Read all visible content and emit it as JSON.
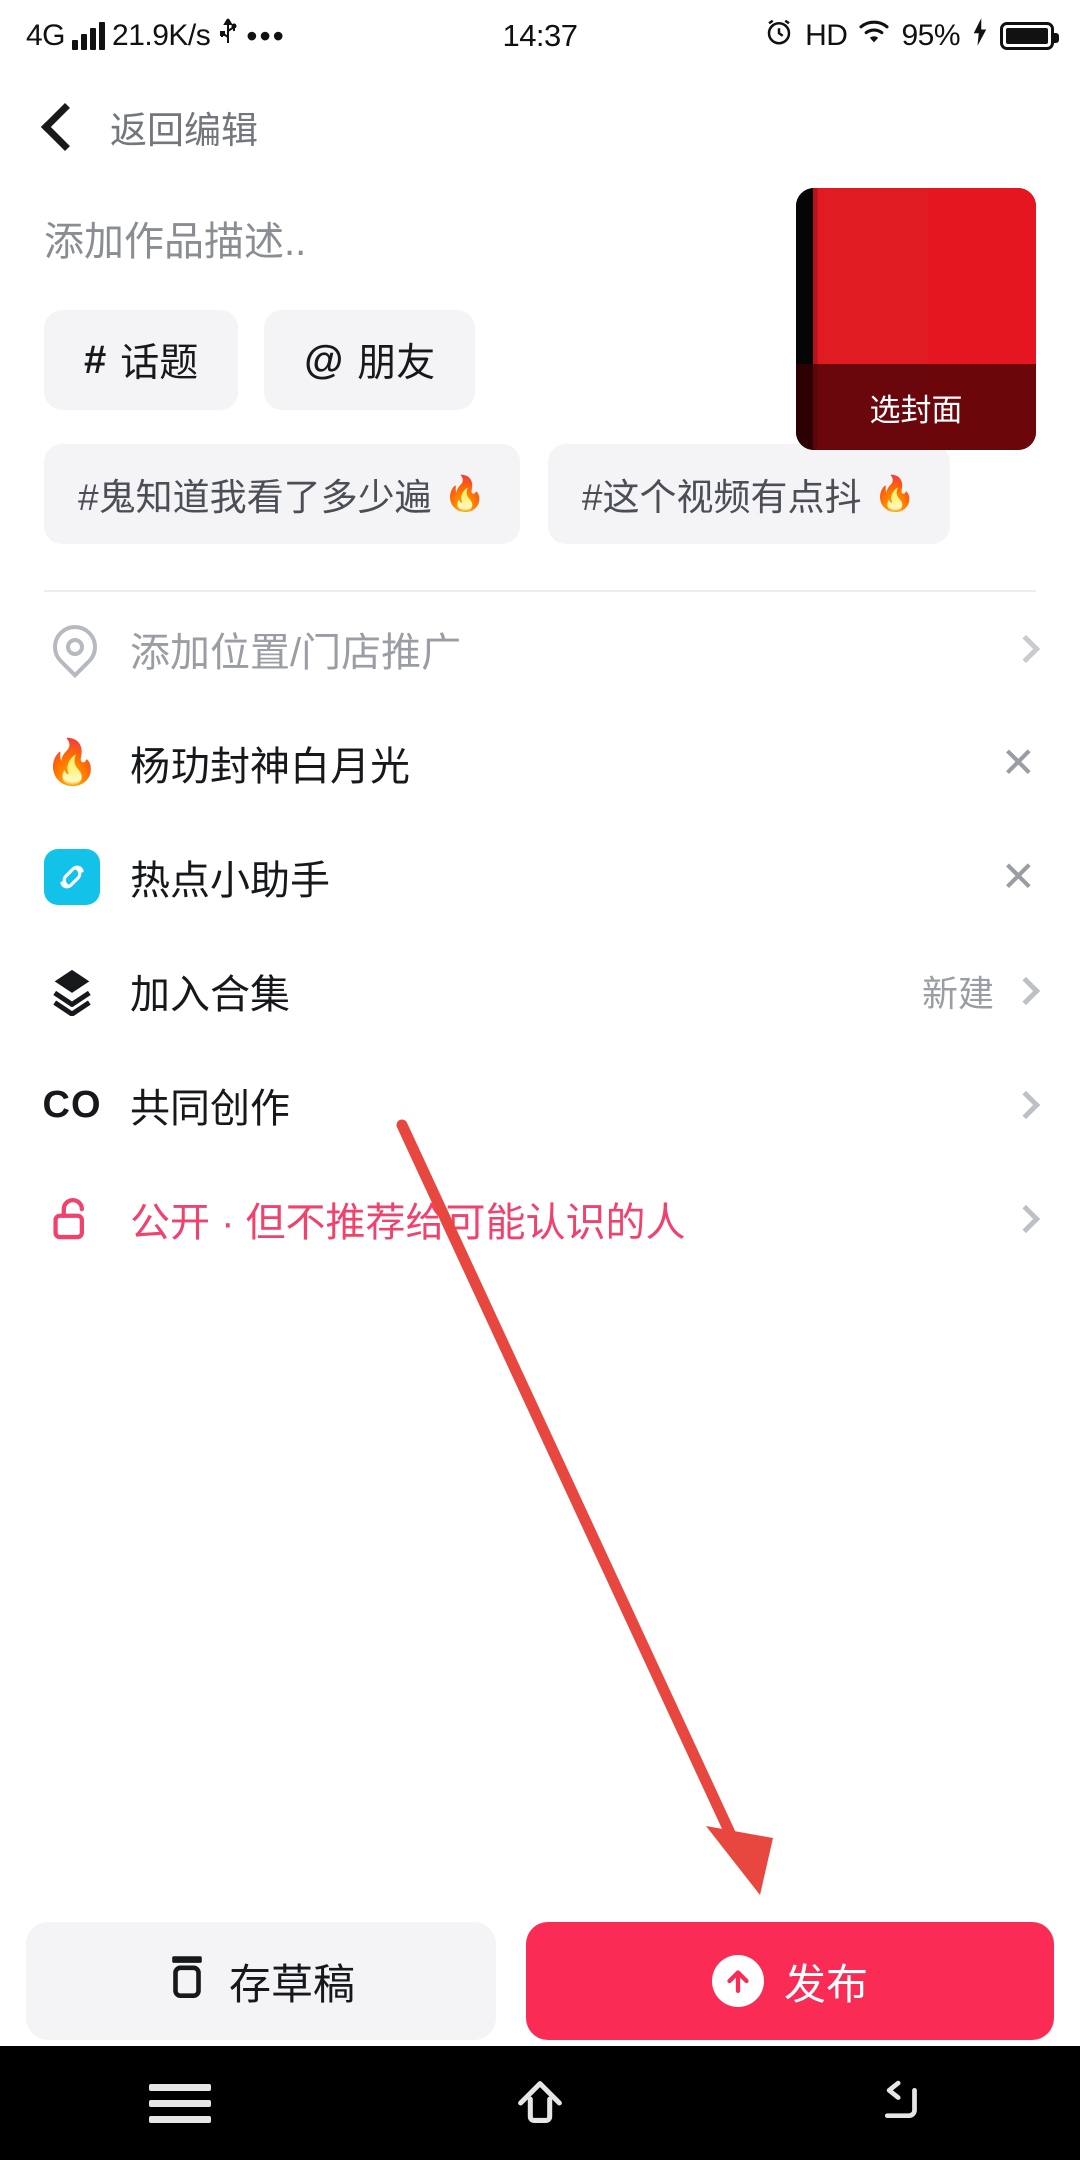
{
  "status_bar": {
    "network": "4G",
    "speed": "21.9K/s",
    "usb_icon": "usb-icon",
    "more_icon": "ellipsis-icon",
    "time": "14:37",
    "alarm_icon": "alarm-icon",
    "hd": "HD",
    "wifi_icon": "wifi-icon",
    "battery_percent": "95%",
    "charging_icon": "lightning-icon"
  },
  "nav": {
    "back_icon": "chevron-left-icon",
    "title": "返回编辑"
  },
  "editor": {
    "description_placeholder": "添加作品描述..",
    "description_value": "",
    "cover": {
      "label": "选封面"
    },
    "chips": [
      {
        "symbol": "#",
        "label": "话题",
        "name": "topic"
      },
      {
        "symbol": "@",
        "label": "朋友",
        "name": "friend"
      }
    ],
    "suggested_tags": [
      {
        "label": "#鬼知道我看了多少遍",
        "fire": "🔥"
      },
      {
        "label": "#这个视频有点抖",
        "fire": "🔥"
      }
    ]
  },
  "options": [
    {
      "name": "location",
      "icon": "location-pin-icon",
      "label": "添加位置/门店推广",
      "right_text": "",
      "right_icon": "chevron-right-icon",
      "muted": true
    },
    {
      "name": "hot-topic",
      "icon": "flame-icon",
      "label": "杨玏封神白月光",
      "right_text": "",
      "right_icon": "close-icon",
      "muted": false
    },
    {
      "name": "hot-assistant",
      "icon": "hot-assistant-app-icon",
      "label": "热点小助手",
      "right_text": "",
      "right_icon": "close-icon",
      "muted": false
    },
    {
      "name": "add-collection",
      "icon": "layers-icon",
      "label": "加入合集",
      "right_text": "新建",
      "right_icon": "chevron-right-icon",
      "muted": false
    },
    {
      "name": "co-creation",
      "icon": "co-icon",
      "label": "共同创作",
      "right_text": "",
      "right_icon": "chevron-right-icon",
      "muted": false
    },
    {
      "name": "privacy",
      "icon": "unlock-icon",
      "label": "公开 · 但不推荐给可能认识的人",
      "right_text": "",
      "right_icon": "chevron-right-icon",
      "muted": false
    }
  ],
  "bottom_actions": {
    "draft_label": "存草稿",
    "draft_icon": "save-draft-icon",
    "publish_label": "发布",
    "publish_icon": "arrow-up-circle-icon"
  },
  "system_nav": {
    "menu_icon": "menu-icon",
    "home_icon": "home-icon",
    "back_icon": "back-arrow-icon"
  },
  "colors": {
    "accent": "#fa2c55",
    "privacy_text": "#f0426c",
    "chip_bg": "#f4f4f6",
    "muted_text": "#9a9da3",
    "annotation_arrow": "#e8473f",
    "app_icon_bg": "#12c2e9"
  }
}
